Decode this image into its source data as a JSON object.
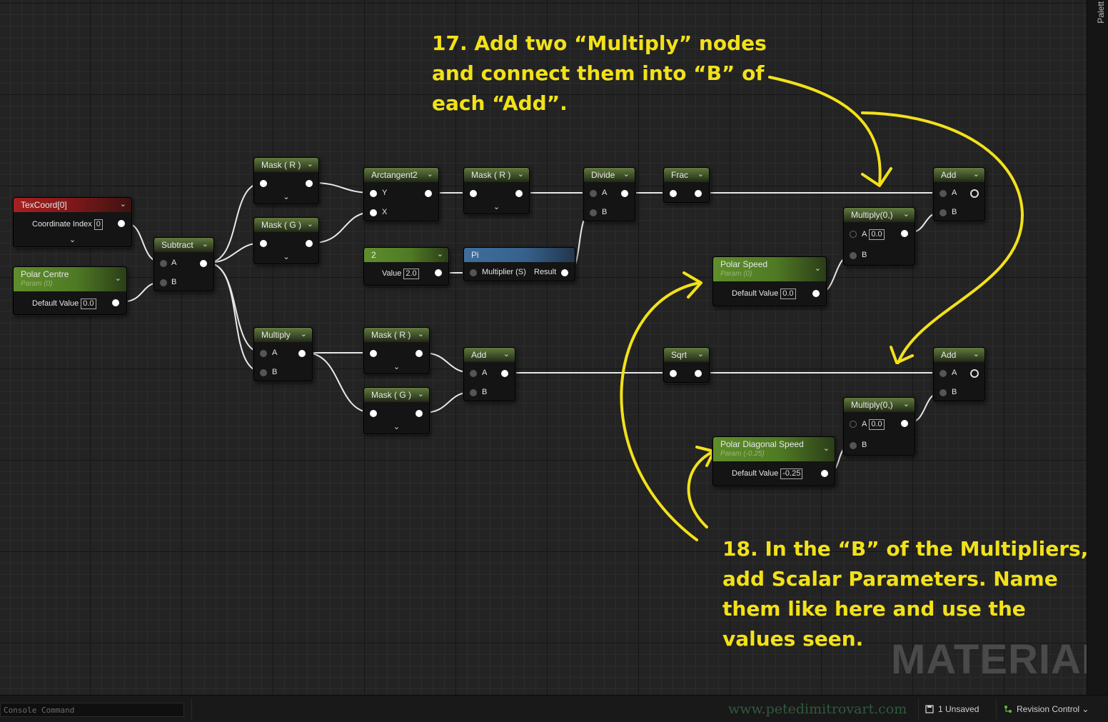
{
  "sidebar": {
    "palette_tab": "Palett"
  },
  "annotations": {
    "step17": [
      "17. Add two “Multiply” nodes",
      "and connect them into “B” of",
      "each “Add”."
    ],
    "step18": [
      "18. In the “B” of the Multipliers,",
      "add Scalar Parameters. Name",
      "them like here and use the",
      "values seen."
    ],
    "color": "#f2e11a"
  },
  "watermark": {
    "material": "MATERIAL",
    "site": "www.petedimitrovart.com"
  },
  "nodes": {
    "texcoord": {
      "title": "TexCoord[0]",
      "coord_label": "Coordinate Index",
      "coord_value": "0"
    },
    "polar_centre": {
      "title": "Polar Centre",
      "param": "Param (0)",
      "default_label": "Default Value",
      "default_value": "0.0"
    },
    "subtract": {
      "title": "Subtract",
      "a": "A",
      "b": "B"
    },
    "mask_r_top": {
      "title": "Mask ( R )"
    },
    "mask_g_top": {
      "title": "Mask ( G )"
    },
    "arctangent2": {
      "title": "Arctangent2",
      "y": "Y",
      "x": "X"
    },
    "const2": {
      "title": "2",
      "value_label": "Value",
      "value": "2.0"
    },
    "mask_r_mid": {
      "title": "Mask ( R )"
    },
    "pi": {
      "title": "Pi",
      "multiplier": "Multiplier (S)",
      "result": "Result"
    },
    "divide": {
      "title": "Divide",
      "a": "A",
      "b": "B"
    },
    "frac": {
      "title": "Frac"
    },
    "multiply_lower": {
      "title": "Multiply",
      "a": "A",
      "b": "B"
    },
    "mask_r_low": {
      "title": "Mask ( R )"
    },
    "mask_g_low": {
      "title": "Mask ( G )"
    },
    "add_lower": {
      "title": "Add",
      "a": "A",
      "b": "B"
    },
    "sqrt": {
      "title": "Sqrt"
    },
    "add_top_right": {
      "title": "Add",
      "a": "A",
      "b": "B"
    },
    "multiply_top_right": {
      "title": "Multiply(0,)",
      "a": "A",
      "a_value": "0.0",
      "b": "B"
    },
    "polar_speed": {
      "title": "Polar Speed",
      "param": "Param (0)",
      "default_label": "Default Value",
      "default_value": "0.0"
    },
    "add_bottom_right": {
      "title": "Add",
      "a": "A",
      "b": "B"
    },
    "multiply_bottom_right": {
      "title": "Multiply(0,)",
      "a": "A",
      "a_value": "0.0",
      "b": "B"
    },
    "polar_diag_speed": {
      "title": "Polar Diagonal Speed",
      "param": "Param (-0.25)",
      "default_label": "Default Value",
      "default_value": "-0.25"
    }
  },
  "statusbar": {
    "console_placeholder": "Console Command",
    "unsaved": "1 Unsaved",
    "revision": "Revision Control"
  }
}
